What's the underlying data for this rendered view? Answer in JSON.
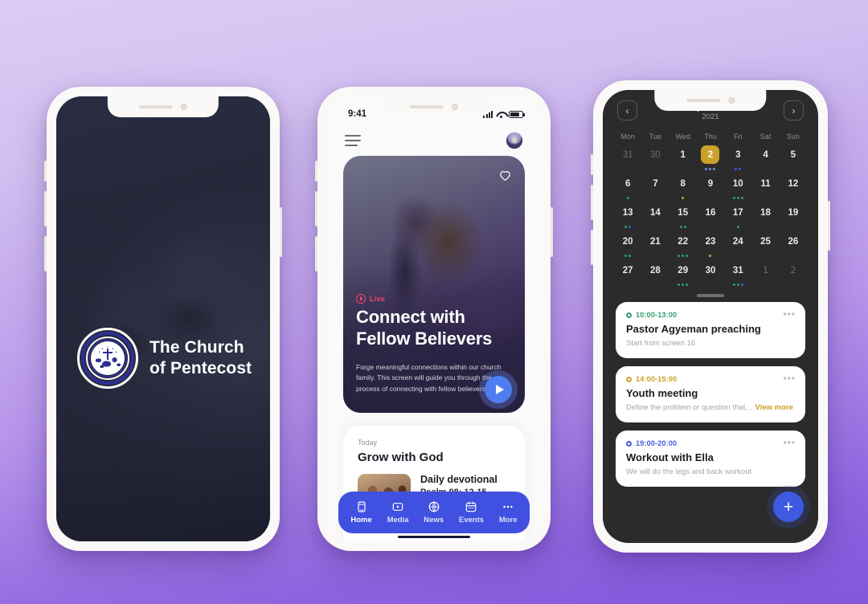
{
  "background": {
    "top_color": "#dbccf4",
    "bottom_color": "#8257dc"
  },
  "phone1": {
    "name": "splash-screen",
    "brand": {
      "line1": "The Church",
      "line2": "of Pentecost"
    },
    "logo_icon": "church-of-pentecost-logo-icon"
  },
  "phone2": {
    "name": "home-screen",
    "statusbar": {
      "time": "9:41",
      "signal_icon": "cellular-signal-icon",
      "wifi_icon": "wifi-icon",
      "battery_icon": "battery-icon"
    },
    "topbar": {
      "menu_icon": "hamburger-menu-icon",
      "avatar_icon": "user-avatar-icon"
    },
    "hero": {
      "heart_icon": "heart-outline-icon",
      "live_label": "Live",
      "live_icon": "live-play-icon",
      "title": "Connect with Fellow Believers",
      "description": "Forge meaningful connections within our church family. This screen will guide you through the process of connecting with fellow believers",
      "play_icon": "play-icon",
      "live_color": "#f0455f",
      "play_color": "#4e7df0"
    },
    "today": {
      "label": "Today",
      "title": "Grow with God",
      "devotional_title": "Daily devotional",
      "devotional_sub": "Psalm 98: 12-15"
    },
    "tabbar": {
      "accent": "#4050e0",
      "items": [
        {
          "label": "Home",
          "icon": "home-device-icon"
        },
        {
          "label": "Media",
          "icon": "media-play-icon"
        },
        {
          "label": "News",
          "icon": "globe-icon"
        },
        {
          "label": "Events",
          "icon": "calendar-icon"
        },
        {
          "label": "More",
          "icon": "ellipsis-icon"
        }
      ]
    }
  },
  "phone3": {
    "name": "calendar-screen",
    "header": {
      "prev_icon": "chevron-left-icon",
      "next_icon": "chevron-right-icon",
      "month": "September",
      "year": "2021"
    },
    "weekdays": [
      "Mon",
      "Tue",
      "Wed",
      "Thu",
      "Fri",
      "Sat",
      "Sun"
    ],
    "selected_day": 2,
    "selected_color": "#c9a227",
    "days": [
      {
        "n": "31",
        "muted": true,
        "dots": []
      },
      {
        "n": "30",
        "muted": true,
        "dots": []
      },
      {
        "n": "1",
        "muted": false,
        "dots": []
      },
      {
        "n": "2",
        "muted": false,
        "selected": true,
        "dots": [
          "#6f8fe0",
          "#6f8fe0",
          "#6f8fe0"
        ]
      },
      {
        "n": "3",
        "muted": false,
        "dots": [
          "#3f5ae0",
          "#3f5ae0"
        ]
      },
      {
        "n": "4",
        "muted": false,
        "dots": []
      },
      {
        "n": "5",
        "muted": false,
        "dots": []
      },
      {
        "n": "6",
        "muted": false,
        "dots": [
          "#2f9e6e"
        ]
      },
      {
        "n": "7",
        "muted": false,
        "dots": []
      },
      {
        "n": "8",
        "muted": false,
        "dots": [
          "#c9a227"
        ]
      },
      {
        "n": "9",
        "muted": false,
        "dots": []
      },
      {
        "n": "10",
        "muted": false,
        "dots": [
          "#2f9e6e",
          "#2f9e6e",
          "#2f9e6e"
        ]
      },
      {
        "n": "11",
        "muted": false,
        "dots": []
      },
      {
        "n": "12",
        "muted": false,
        "dots": []
      },
      {
        "n": "13",
        "muted": false,
        "dots": [
          "#2f9e6e",
          "#3f5ae0"
        ]
      },
      {
        "n": "14",
        "muted": false,
        "dots": []
      },
      {
        "n": "15",
        "muted": false,
        "dots": [
          "#2f9e6e",
          "#2f9e6e"
        ]
      },
      {
        "n": "16",
        "muted": false,
        "dots": []
      },
      {
        "n": "17",
        "muted": false,
        "dots": [
          "#2f9e6e"
        ]
      },
      {
        "n": "18",
        "muted": false,
        "dots": []
      },
      {
        "n": "19",
        "muted": false,
        "dots": []
      },
      {
        "n": "20",
        "muted": false,
        "dots": [
          "#2f9e6e",
          "#2f9e6e"
        ]
      },
      {
        "n": "21",
        "muted": false,
        "dots": []
      },
      {
        "n": "22",
        "muted": false,
        "dots": [
          "#2f9e6e",
          "#2f9e6e",
          "#2f9e6e"
        ]
      },
      {
        "n": "23",
        "muted": false,
        "dots": [
          "#c9a227"
        ]
      },
      {
        "n": "24",
        "muted": false,
        "dots": []
      },
      {
        "n": "25",
        "muted": false,
        "dots": []
      },
      {
        "n": "26",
        "muted": false,
        "dots": []
      },
      {
        "n": "27",
        "muted": false,
        "dots": []
      },
      {
        "n": "28",
        "muted": false,
        "dots": []
      },
      {
        "n": "29",
        "muted": false,
        "dots": [
          "#2f9e6e",
          "#2f9e6e",
          "#2f9e6e"
        ]
      },
      {
        "n": "30",
        "muted": false,
        "dots": []
      },
      {
        "n": "31",
        "muted": false,
        "dots": [
          "#2f9e6e",
          "#2f9e6e",
          "#3f5ae0"
        ]
      },
      {
        "n": "1",
        "muted": true,
        "dots": []
      },
      {
        "n": "2",
        "muted": true,
        "dots": []
      }
    ],
    "events": [
      {
        "time": "10:00-13:00",
        "title": "Pastor Agyeman preaching",
        "sub": "Start from screen 16",
        "dot_color": "#2f9e6e",
        "more_icon": "ellipsis-icon",
        "link": ""
      },
      {
        "time": "14:00-15:00",
        "title": "Youth meeting",
        "sub": "Define the problem or question that…",
        "dot_color": "#c9a227",
        "more_icon": "ellipsis-icon",
        "link": "View more"
      },
      {
        "time": "19:00-20:00",
        "title": "Workout with Ella",
        "sub": "We will do the legs and back workout",
        "dot_color": "#3f5ae0",
        "more_icon": "ellipsis-icon",
        "link": ""
      }
    ],
    "fab": {
      "icon": "plus-icon",
      "label": "+",
      "color": "#3f5ae0"
    }
  }
}
